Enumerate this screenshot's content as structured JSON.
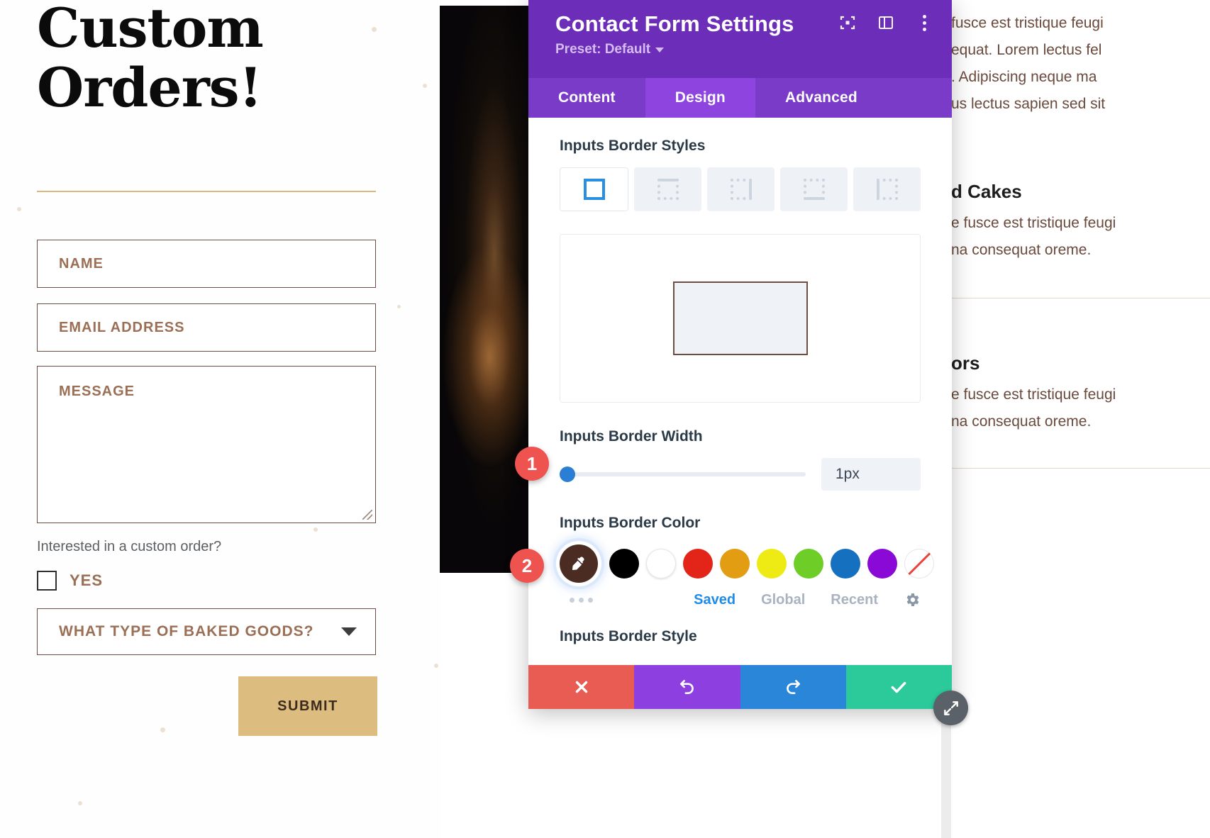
{
  "left_page": {
    "title": "Custom Orders!",
    "fields": [
      {
        "name": "name",
        "placeholder": "NAME"
      },
      {
        "name": "email",
        "placeholder": "EMAIL ADDRESS"
      },
      {
        "name": "message",
        "placeholder": "MESSAGE"
      }
    ],
    "question_label": "Interested in a custom order?",
    "checkbox_label": "YES",
    "select_placeholder": "WHAT TYPE OF BAKED GOODS?",
    "submit_label": "SUBMIT",
    "accent_color": "#ddbd7f",
    "field_border_color": "#6d4c41",
    "placeholder_color": "#9b6f55"
  },
  "right_page": {
    "paragraph_top": [
      "fusce est tristique feugi",
      "equat. Lorem lectus fel",
      ". Adipiscing neque ma",
      "us lectus sapien sed sit"
    ],
    "heading_1": "d Cakes",
    "paragraph_1": [
      "e fusce est tristique feugi",
      "na consequat oreme."
    ],
    "heading_2": "ors",
    "paragraph_2": [
      "e fusce est tristique feugi",
      "na consequat oreme."
    ]
  },
  "panel": {
    "title": "Contact Form Settings",
    "preset_label": "Preset: Default",
    "header_icons": [
      {
        "name": "focus-icon"
      },
      {
        "name": "layout-icon"
      },
      {
        "name": "more-options-icon"
      }
    ],
    "tabs": [
      {
        "label": "Content",
        "active": false
      },
      {
        "label": "Design",
        "active": true
      },
      {
        "label": "Advanced",
        "active": false
      }
    ],
    "border_styles": {
      "label": "Inputs Border Styles",
      "options": [
        {
          "name": "border-all",
          "active": true
        },
        {
          "name": "border-top",
          "active": false
        },
        {
          "name": "border-right",
          "active": false
        },
        {
          "name": "border-bottom",
          "active": false
        },
        {
          "name": "border-left",
          "active": false
        }
      ]
    },
    "preview": {
      "border_color": "#6d4c41",
      "fill": "#eff2f7"
    },
    "border_width": {
      "label": "Inputs Border Width",
      "value": "1px",
      "slider_percent": 0
    },
    "border_color": {
      "label": "Inputs Border Color",
      "selected": "#4a2c22",
      "swatches": [
        "#000000",
        "#ffffff",
        "#e32419",
        "#e29d12",
        "#eeeb14",
        "#6ece27",
        "#1571bf",
        "#8a09d6"
      ],
      "none_swatch": "transparent",
      "links": [
        {
          "label": "Saved",
          "active": true
        },
        {
          "label": "Global",
          "active": false
        },
        {
          "label": "Recent",
          "active": false
        }
      ]
    },
    "border_style_label": "Inputs Border Style",
    "actions": [
      {
        "name": "close-button",
        "color": "#e85c54"
      },
      {
        "name": "undo-button",
        "color": "#8d3fe0"
      },
      {
        "name": "redo-button",
        "color": "#2a86d8"
      },
      {
        "name": "save-button",
        "color": "#2cc99a"
      }
    ],
    "accent_color": "#6c2eb9"
  },
  "callouts": [
    {
      "number": "1",
      "target": "border-width-slider"
    },
    {
      "number": "2",
      "target": "border-color-selected-swatch"
    }
  ]
}
